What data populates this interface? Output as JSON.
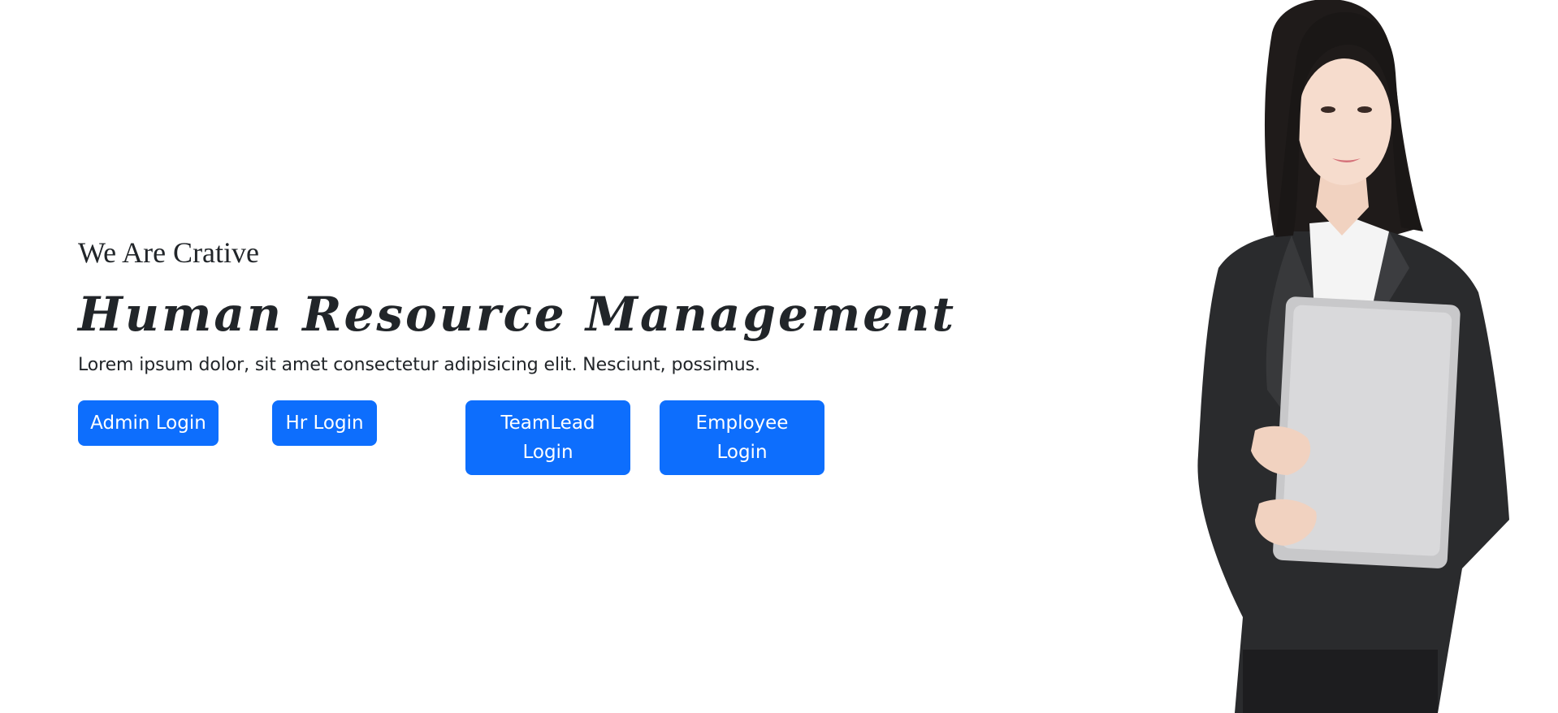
{
  "hero": {
    "tagline": "We Are Crative",
    "title": "Human Resource Management",
    "description": "Lorem ipsum dolor, sit amet consectetur adipisicing elit. Nesciunt, possimus."
  },
  "buttons": {
    "admin": "Admin Login",
    "hr": "Hr Login",
    "teamlead": "TeamLead Login",
    "employee": "Employee Login"
  },
  "colors": {
    "primary_button": "#0d6efd",
    "text": "#212529",
    "background": "#ffffff"
  }
}
